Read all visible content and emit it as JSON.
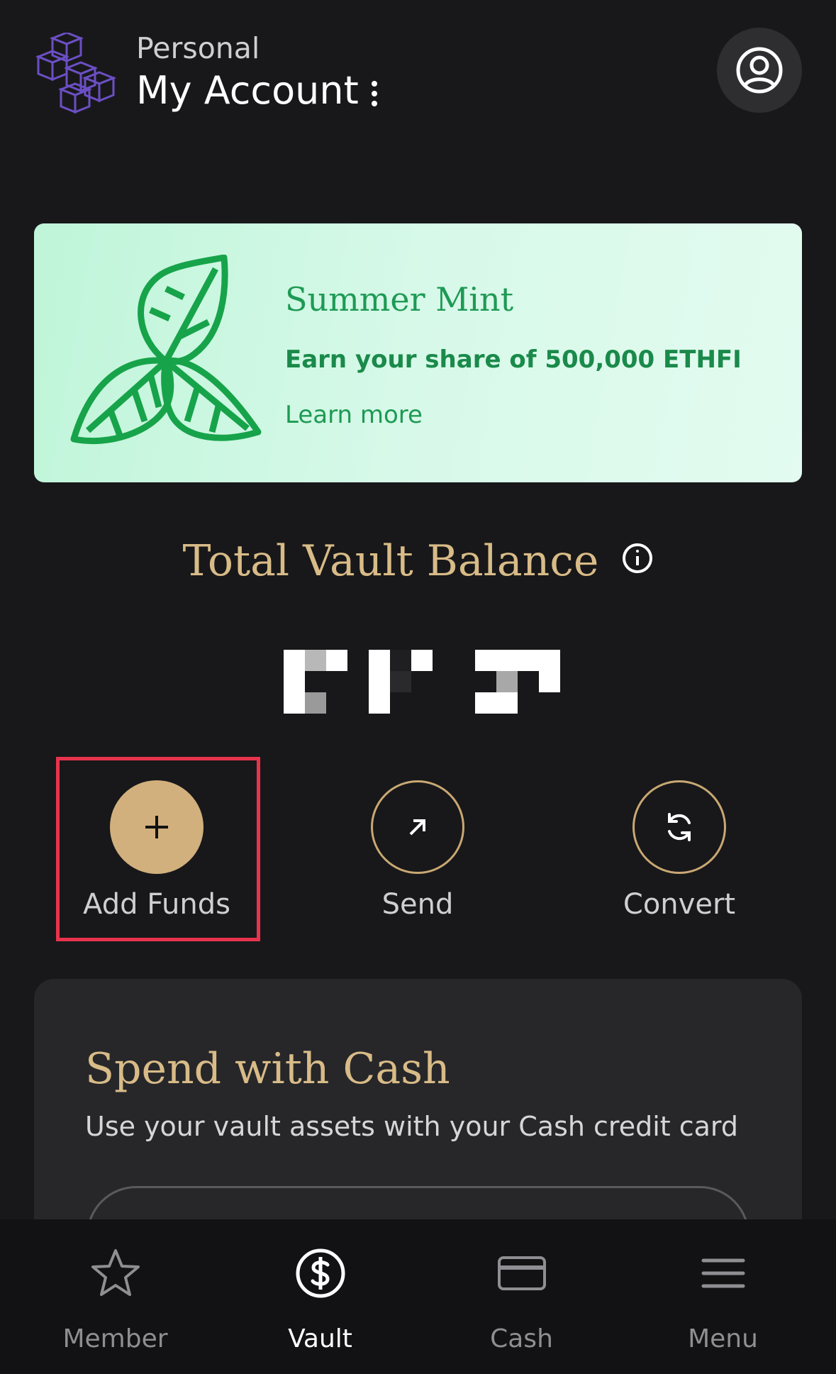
{
  "header": {
    "account_type": "Personal",
    "account_name": "My Account"
  },
  "promo": {
    "title": "Summer Mint",
    "subtitle": "Earn your share of 500,000 ETHFI",
    "link": "Learn more"
  },
  "balance": {
    "title": "Total Vault Balance"
  },
  "actions": [
    {
      "label": "Add Funds",
      "icon": "plus-icon"
    },
    {
      "label": "Send",
      "icon": "arrow-up-right-icon"
    },
    {
      "label": "Convert",
      "icon": "refresh-icon"
    }
  ],
  "spend": {
    "title": "Spend with Cash",
    "subtitle": "Use your vault assets with your Cash credit card"
  },
  "tabs": [
    {
      "label": "Member",
      "icon": "star-icon"
    },
    {
      "label": "Vault",
      "icon": "dollar-circle-icon"
    },
    {
      "label": "Cash",
      "icon": "card-icon"
    },
    {
      "label": "Menu",
      "icon": "hamburger-icon"
    }
  ],
  "colors": {
    "background": "#18181a",
    "accent_gold": "#d2b07d",
    "promo_green": "#1e9a54",
    "highlight_red": "#e8334d"
  }
}
